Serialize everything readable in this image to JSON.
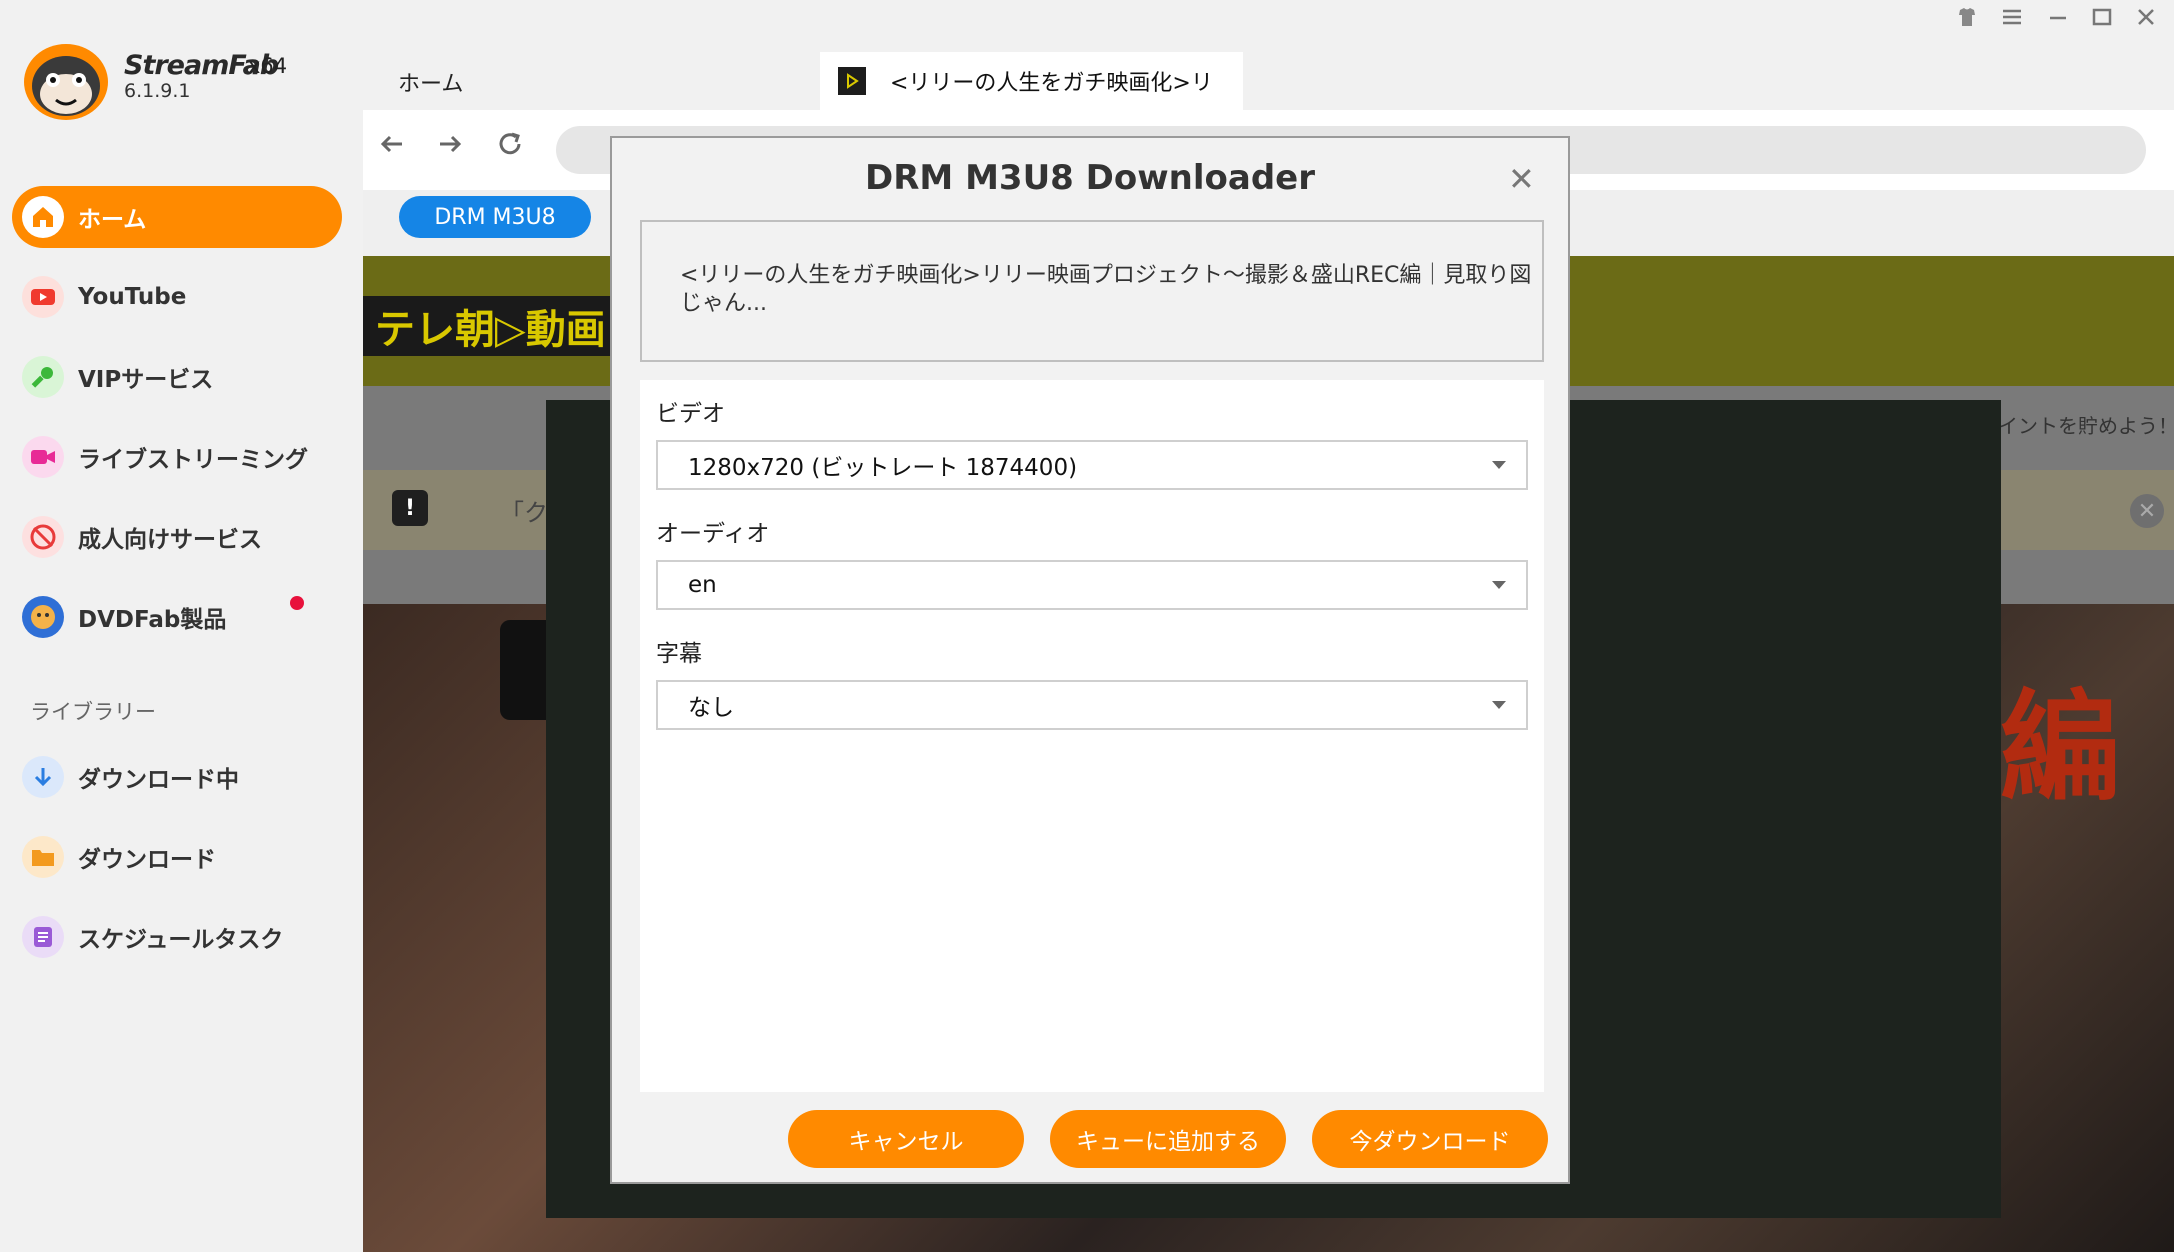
{
  "app": {
    "brand": "StreamFab",
    "arch": "x64",
    "version": "6.1.9.1"
  },
  "sidebar": {
    "items": [
      {
        "label": "ホーム",
        "icon": "home-icon",
        "active": true
      },
      {
        "label": "YouTube",
        "icon": "youtube-icon"
      },
      {
        "label": "VIPサービス",
        "icon": "key-icon"
      },
      {
        "label": "ライブストリーミング",
        "icon": "live-camera-icon"
      },
      {
        "label": "成人向けサービス",
        "icon": "adult-icon"
      },
      {
        "label": "DVDFab製品",
        "icon": "dvdfab-icon"
      }
    ],
    "library_heading": "ライブラリー",
    "library": [
      {
        "label": "ダウンロード中",
        "icon": "download-arrow-icon"
      },
      {
        "label": "ダウンロード",
        "icon": "folder-icon"
      },
      {
        "label": "スケジュールタスク",
        "icon": "schedule-list-icon"
      }
    ]
  },
  "tabs": {
    "home": "ホーム",
    "active_title": "<リリーの人生をガチ映画化>リ"
  },
  "toolbar": {
    "drm_label": "DRM M3U8"
  },
  "web": {
    "logo_text": "テレ朝▷動画",
    "notice_text": "「ク",
    "notice_icon": "!",
    "points_text": "イントを貯めよう！",
    "hero_text": "編"
  },
  "dialog": {
    "title": "DRM M3U8 Downloader",
    "video_title": "<リリーの人生をガチ映画化>リリー映画プロジェクト〜撮影＆盛山REC編｜見取り図じゃん...",
    "video_label": "ビデオ",
    "video_value": "1280x720 (ビットレート 1874400)",
    "audio_label": "オーディオ",
    "audio_value": "en",
    "subtitle_label": "字幕",
    "subtitle_value": "なし",
    "cancel": "キャンセル",
    "queue": "キューに追加する",
    "download": "今ダウンロード"
  },
  "colors": {
    "accent": "#ff8a00",
    "blue": "#1585e6",
    "badge": "#e8113c"
  }
}
